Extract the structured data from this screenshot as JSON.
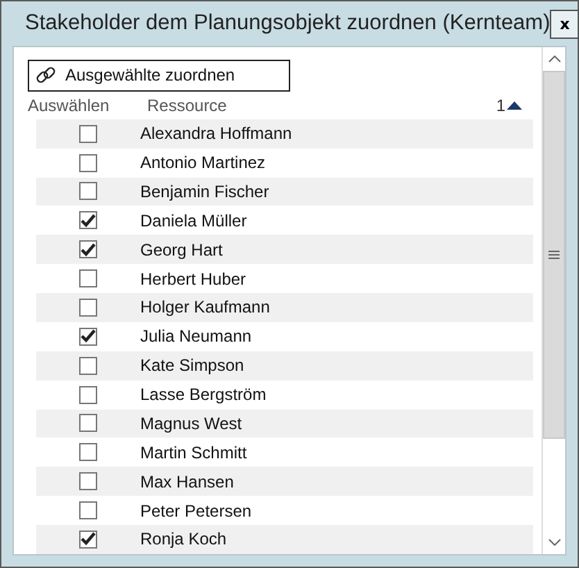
{
  "window": {
    "title": "Stakeholder dem Planungsobjekt zuordnen (Kernteam)",
    "close": "x"
  },
  "assign_button": {
    "label": "Ausgewählte zuordnen"
  },
  "table": {
    "columns": [
      {
        "label": "Auswählen"
      },
      {
        "label": "Ressource"
      }
    ],
    "sort": {
      "order": "1",
      "ascending": true
    },
    "rows": [
      {
        "name": "Alexandra Hoffmann",
        "checked": false
      },
      {
        "name": "Antonio Martinez",
        "checked": false
      },
      {
        "name": "Benjamin Fischer",
        "checked": false
      },
      {
        "name": "Daniela Müller",
        "checked": true
      },
      {
        "name": "Georg Hart",
        "checked": true
      },
      {
        "name": "Herbert Huber",
        "checked": false
      },
      {
        "name": "Holger Kaufmann",
        "checked": false
      },
      {
        "name": "Julia Neumann",
        "checked": true
      },
      {
        "name": "Kate Simpson",
        "checked": false
      },
      {
        "name": "Lasse Bergström",
        "checked": false
      },
      {
        "name": "Magnus West",
        "checked": false
      },
      {
        "name": "Martin Schmitt",
        "checked": false
      },
      {
        "name": "Max Hansen",
        "checked": false
      },
      {
        "name": "Peter Petersen",
        "checked": false
      },
      {
        "name": "Ronja Koch",
        "checked": true
      }
    ]
  }
}
